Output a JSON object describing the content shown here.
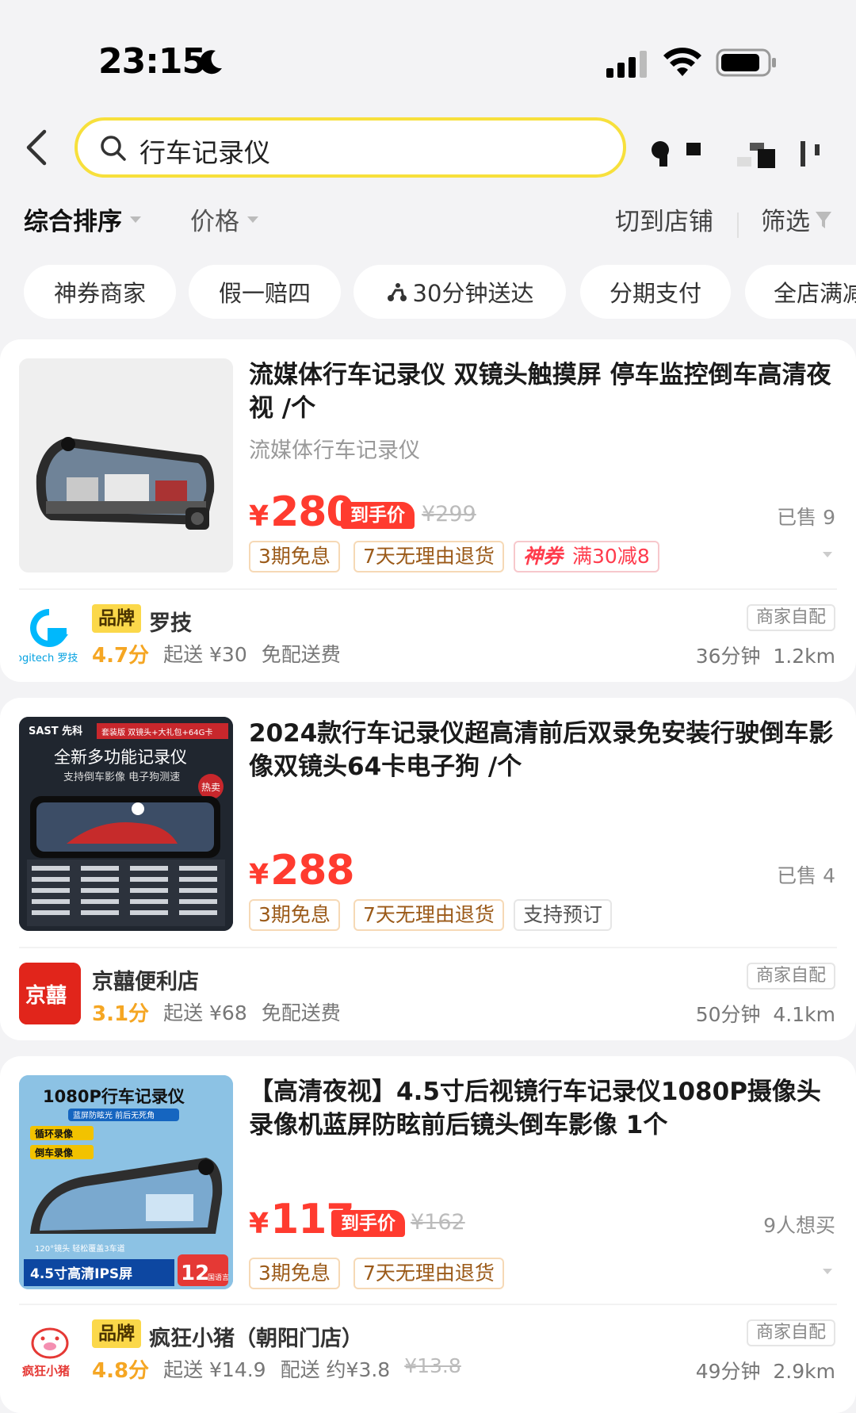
{
  "status_bar": {
    "time": "23:15"
  },
  "search": {
    "query": "行车记录仪"
  },
  "sort": {
    "active": "综合排序",
    "price": "价格",
    "switch_store": "切到店铺",
    "filter": "筛选"
  },
  "chips": [
    "神券商家",
    "假一赔四",
    "30分钟送达",
    "分期支付",
    "全店满减"
  ],
  "products": [
    {
      "title": "流媒体行车记录仪 双镜头触摸屏 停车监控倒车高清夜视 /个",
      "subtitle": "流媒体行车记录仪",
      "price": "280",
      "yen": "¥",
      "final_label": "到手价",
      "old_price": "¥299",
      "sold": "已售 9",
      "tags": [
        "3期免息",
        "7天无理由退货"
      ],
      "coupon": {
        "left": "神券",
        "right": "满30减8"
      },
      "store": {
        "brand_label": "品牌",
        "name": "罗技",
        "score": "4.7分",
        "min_order": "起送 ¥30",
        "fee": "免配送费",
        "delivery_badge": "商家自配",
        "eta": "36分钟",
        "distance": "1.2km",
        "logo_text": "ogitech 罗技"
      }
    },
    {
      "title": "2024款行车记录仪超高清前后双录免安装行驶倒车影像双镜头64卡电子狗 /个",
      "price": "288",
      "yen": "¥",
      "sold": "已售 4",
      "tags": [
        "3期免息",
        "7天无理由退货",
        "支持预订"
      ],
      "thumb_text": {
        "brand": "SAST 先科",
        "pack": "套装版 双镜头+大礼包+64G卡",
        "head": "全新多功能记录仪",
        "sub": "支持倒车影像 电子狗测速",
        "hot": "热卖"
      },
      "store": {
        "name": "京囍便利店",
        "score": "3.1分",
        "min_order": "起送 ¥68",
        "fee": "免配送费",
        "delivery_badge": "商家自配",
        "eta": "50分钟",
        "distance": "4.1km",
        "logo_text": "京囍"
      }
    },
    {
      "title": "【高清夜视】4.5寸后视镜行车记录仪1080P摄像头录像机蓝屏防眩前后镜头倒车影像 1个",
      "price": "117",
      "yen": "¥",
      "final_label": "到手价",
      "old_price": "¥162",
      "sold": "9人想买",
      "tags": [
        "3期免息",
        "7天无理由退货"
      ],
      "thumb_text": {
        "head": "1080P行车记录仪",
        "sub": "蓝屏防眩光 前后无死角",
        "loop": "循环录像",
        "reverse": "倒车录像",
        "bottom": "4.5寸高清IPS屏",
        "lang": "12",
        "lang2": "国语言",
        "lens": "120°镜头 轻松覆盖3车道"
      },
      "store": {
        "brand_label": "品牌",
        "name": "疯狂小猪（朝阳门店）",
        "score": "4.8分",
        "min_order": "起送 ¥14.9",
        "fee": "配送 约¥3.8",
        "fee_old": "¥13.8",
        "delivery_badge": "商家自配",
        "eta": "49分钟",
        "distance": "2.9km",
        "logo_text": "疯狂小猪"
      }
    }
  ]
}
